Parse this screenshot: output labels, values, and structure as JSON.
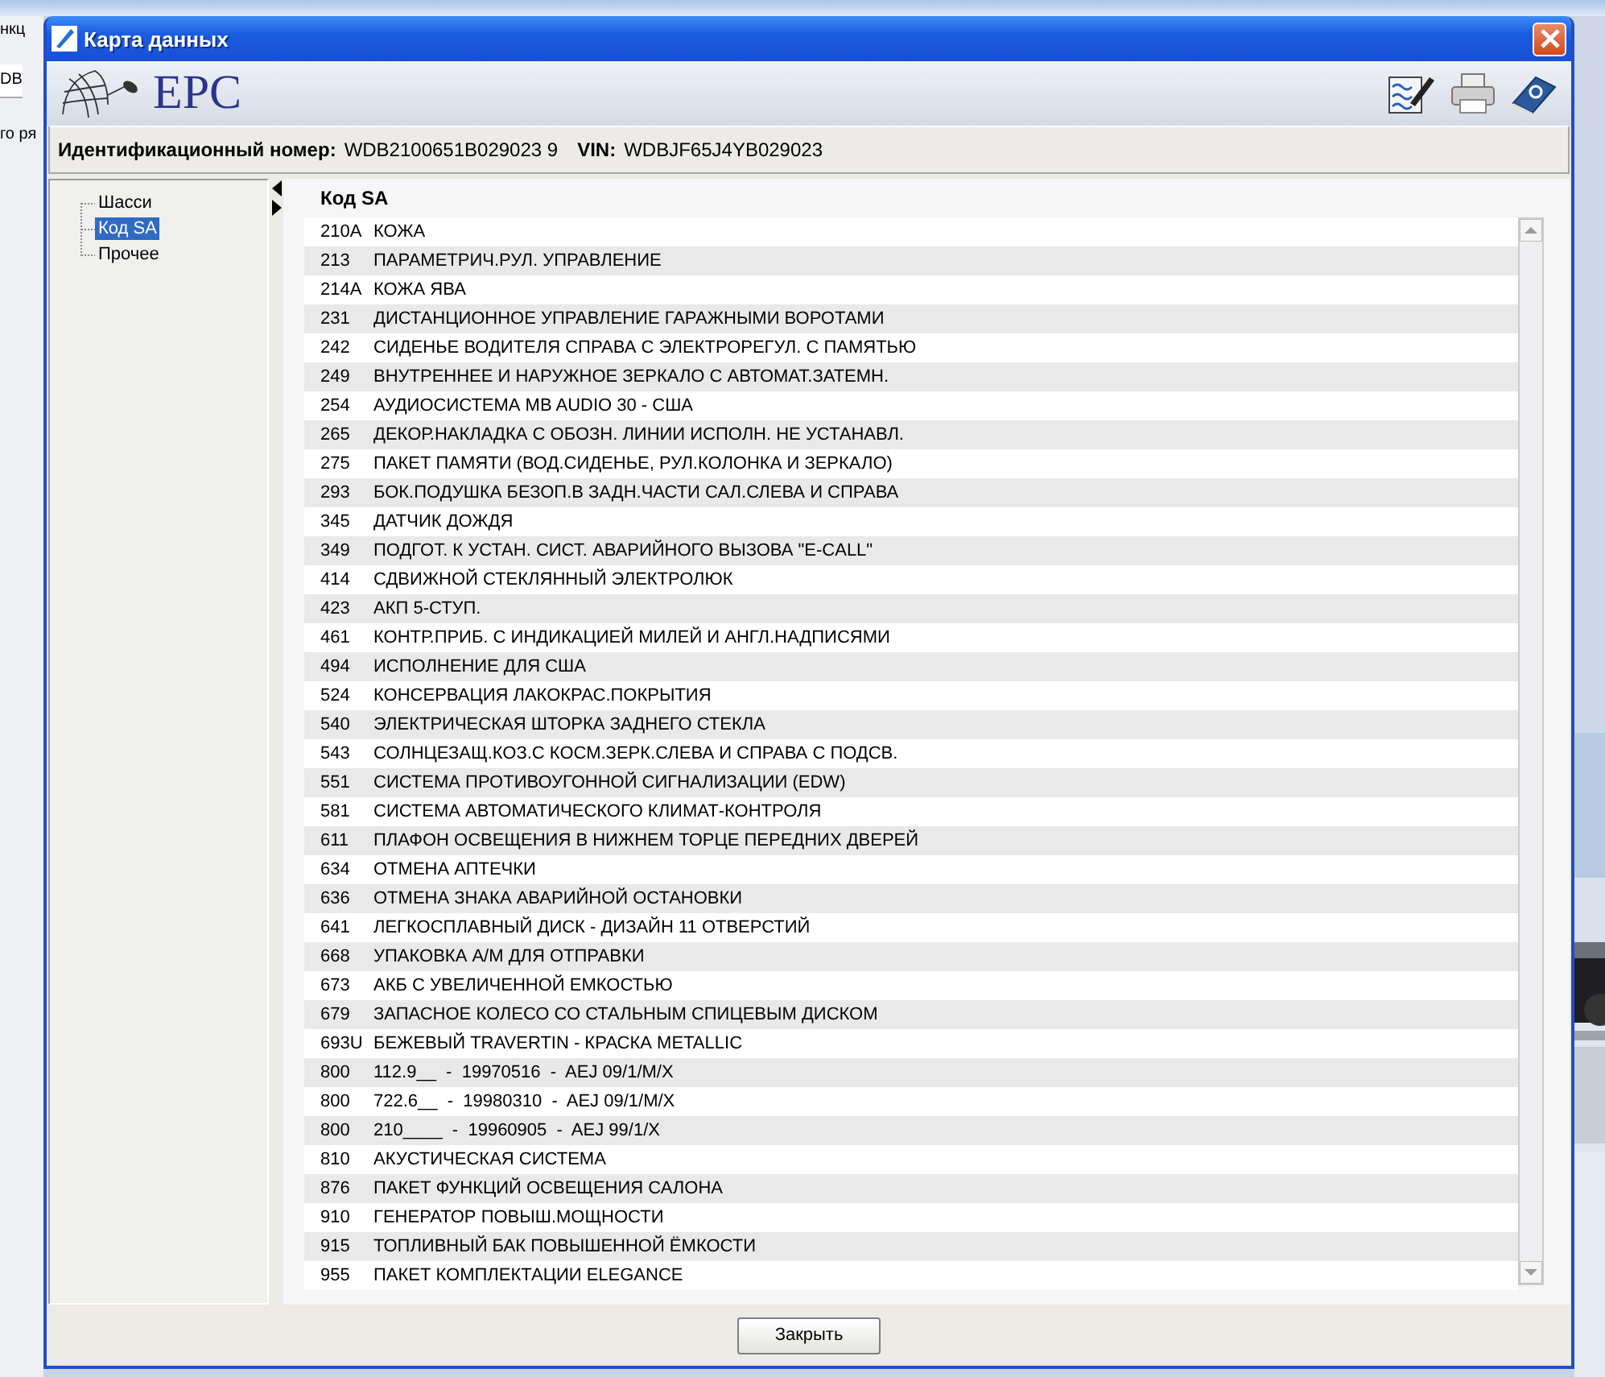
{
  "background": {
    "fragments": [
      "нкц",
      "DB",
      "го ря"
    ]
  },
  "window": {
    "title": "Карта данных"
  },
  "logo": {
    "text": "EPC"
  },
  "info": [
    {
      "label": "Идентификационный номер:",
      "value": "WDB2100651B029023 9"
    },
    {
      "label": "VIN:",
      "value": "WDBJF65J4YB029023"
    }
  ],
  "tree": {
    "items": [
      {
        "label": "Шасси",
        "selected": false
      },
      {
        "label": "Код SA",
        "selected": true
      },
      {
        "label": "Прочее",
        "selected": false
      }
    ]
  },
  "list": {
    "title": "Код SA",
    "rows": [
      {
        "code": "210A",
        "text": "КОЖА"
      },
      {
        "code": "213",
        "text": "ПАРАМЕТРИЧ.РУЛ. УПРАВЛЕНИЕ"
      },
      {
        "code": "214A",
        "text": "КОЖА ЯВА"
      },
      {
        "code": "231",
        "text": "ДИСТАНЦИОННОЕ УПРАВЛЕНИЕ ГАРАЖНЫМИ ВОРОТАМИ"
      },
      {
        "code": "242",
        "text": "СИДЕНЬЕ ВОДИТЕЛЯ СПРАВА С ЭЛЕКТРОРЕГУЛ. С ПАМЯТЬЮ"
      },
      {
        "code": "249",
        "text": "ВНУТРЕННЕЕ И НАРУЖНОЕ ЗЕРКАЛО С АВТОМАТ.ЗАТЕМН."
      },
      {
        "code": "254",
        "text": "АУДИОСИСТЕМА MB AUDIO 30 - США"
      },
      {
        "code": "265",
        "text": "ДЕКОР.НАКЛАДКА С ОБОЗН. ЛИНИИ ИСПОЛН. НЕ УСТАНАВЛ."
      },
      {
        "code": "275",
        "text": "ПАКЕТ ПАМЯТИ (ВОД.СИДЕНЬЕ, РУЛ.КОЛОНКА И ЗЕРКАЛО)"
      },
      {
        "code": "293",
        "text": "БОК.ПОДУШКА БЕЗОП.В ЗАДН.ЧАСТИ САЛ.СЛЕВА И СПРАВА"
      },
      {
        "code": "345",
        "text": "ДАТЧИК ДОЖДЯ"
      },
      {
        "code": "349",
        "text": "ПОДГОТ. К УСТАН. СИСТ. АВАРИЙНОГО ВЫЗОВА \"E-CALL\""
      },
      {
        "code": "414",
        "text": "СДВИЖНОЙ СТЕКЛЯННЫЙ ЭЛЕКТРОЛЮК"
      },
      {
        "code": "423",
        "text": "АКП 5-СТУП."
      },
      {
        "code": "461",
        "text": "КОНТР.ПРИБ. С ИНДИКАЦИЕЙ МИЛЕЙ И АНГЛ.НАДПИСЯМИ"
      },
      {
        "code": "494",
        "text": "ИСПОЛНЕНИЕ ДЛЯ США"
      },
      {
        "code": "524",
        "text": "КОНСЕРВАЦИЯ ЛАКОКРАС.ПОКРЫТИЯ"
      },
      {
        "code": "540",
        "text": "ЭЛЕКТРИЧЕСКАЯ ШТОРКА ЗАДНЕГО СТЕКЛА"
      },
      {
        "code": "543",
        "text": "СОЛНЦЕЗАЩ.КОЗ.С КОСМ.ЗЕРК.СЛЕВА И СПРАВА С ПОДСВ."
      },
      {
        "code": "551",
        "text": "СИСТЕМА ПРОТИВОУГОННОЙ СИГНАЛИЗАЦИИ (EDW)"
      },
      {
        "code": "581",
        "text": "СИСТЕМА АВТОМАТИЧЕСКОГО КЛИМАТ-КОНТРОЛЯ"
      },
      {
        "code": "611",
        "text": "ПЛАФОН ОСВЕЩЕНИЯ В НИЖНЕМ ТОРЦЕ ПЕРЕДНИХ ДВЕРЕЙ"
      },
      {
        "code": "634",
        "text": "ОТМЕНА АПТЕЧКИ"
      },
      {
        "code": "636",
        "text": "ОТМЕНА ЗНАКА АВАРИЙНОЙ ОСТАНОВКИ"
      },
      {
        "code": "641",
        "text": "ЛЕГКОСПЛАВНЫЙ ДИСК - ДИЗАЙН 11 ОТВЕРСТИЙ"
      },
      {
        "code": "668",
        "text": "УПАКОВКА А/М ДЛЯ ОТПРАВКИ"
      },
      {
        "code": "673",
        "text": "АКБ С УВЕЛИЧЕННОЙ ЕМКОСТЬЮ"
      },
      {
        "code": "679",
        "text": "ЗАПАСНОЕ КОЛЕСО СО СТАЛЬНЫМ СПИЦЕВЫМ ДИСКОМ"
      },
      {
        "code": "693U",
        "text": "БЕЖЕВЫЙ TRAVERTIN - КРАСКА METALLIC"
      },
      {
        "code": "800",
        "text": "112.9__  -  19970516  -  AEJ 09/1/M/X"
      },
      {
        "code": "800",
        "text": "722.6__  -  19980310  -  AEJ 09/1/M/X"
      },
      {
        "code": "800",
        "text": "210____  -  19960905  -  AEJ 99/1/X"
      },
      {
        "code": "810",
        "text": "АКУСТИЧЕСКАЯ СИСТЕМА"
      },
      {
        "code": "876",
        "text": "ПАКЕТ ФУНКЦИЙ ОСВЕЩЕНИЯ САЛОНА"
      },
      {
        "code": "910",
        "text": "ГЕНЕРАТОР ПОВЫШ.МОЩНОСТИ"
      },
      {
        "code": "915",
        "text": "ТОПЛИВНЫЙ БАК ПОВЫШЕННОЙ ЁМКОСТИ"
      },
      {
        "code": "955",
        "text": "ПАКЕТ КОМПЛЕКТАЦИИ ELEGANCE"
      }
    ]
  },
  "buttons": [
    "Закрыть"
  ]
}
